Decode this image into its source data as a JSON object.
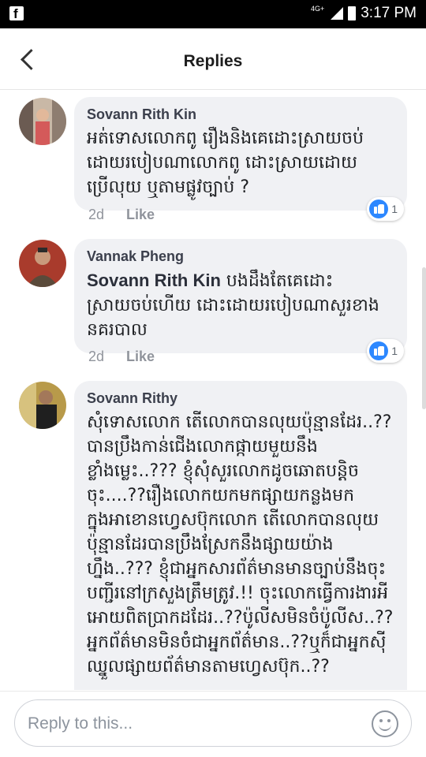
{
  "status_bar": {
    "app_icon": "facebook-icon",
    "network": "4G+",
    "time": "3:17 PM"
  },
  "header": {
    "title": "Replies",
    "back_icon": "back-arrow-icon"
  },
  "comments": [
    {
      "author": "Sovann Rith Kin",
      "mention": "",
      "text": "អត់ទោសលោកពូ រឿងនិងគេដោះស្រាយចប់ដោយរបៀបណាលោកពូ ដោះស្រាយដោយប្រើលុយ ឬតាមផ្លូវច្បាប់ ?",
      "time": "2d",
      "like_label": "Like",
      "reaction_count": "1"
    },
    {
      "author": "Vannak Pheng",
      "mention": "Sovann Rith Kin",
      "text": " បងដឹងតែគេដោះស្រាយចប់ហើយ ដោះដោយរបៀបណាសួរខាងនគរបាល",
      "time": "2d",
      "like_label": "Like",
      "reaction_count": "1"
    },
    {
      "author": "Sovann Rithy",
      "mention": "",
      "text": "សុំទោសលោក តើលោកបានលុយប៉ុន្មានដែរ..??បានប្រឹងកាន់ជើងលោកផ្កាយមួយនឹងខ្លាំងម្លេះ..??? ខ្ញុំសុំសួរលោកដូចឆោតបន្តិចចុះ....??រឿងលោកយកមកផ្សាយកន្លងមកក្នុងអាខោនហ្វេសប៊ុកលោក តើលោកបានលុយប៉ុន្មានដែរបានប្រឹងស្រែកនឹងផ្សាយយ៉ាងហ្នឹង..??? ខ្ញុំជាអ្នកសារព័ត៌មានមានច្បាប់នឹងចុះបញ្ជីរនៅក្រសួងត្រឹមត្រូវ.!! ចុះលោកធ្វើការងារអីអោយពិតប្រាកដដែរ..??ប៉ូលីសមិនចំប៉ូលីស..??អ្នកព័ត៌មានមិនចំជាអ្នកព័ត៌មាន..??ឬក៏ជាអ្នកស៊ីឈ្នួលផ្សាយព័ត៌មានតាមហ្វេសប៊ុក..??"
    }
  ],
  "reply_bar": {
    "placeholder": "Reply to this...",
    "emoji_icon": "smiley-icon"
  }
}
